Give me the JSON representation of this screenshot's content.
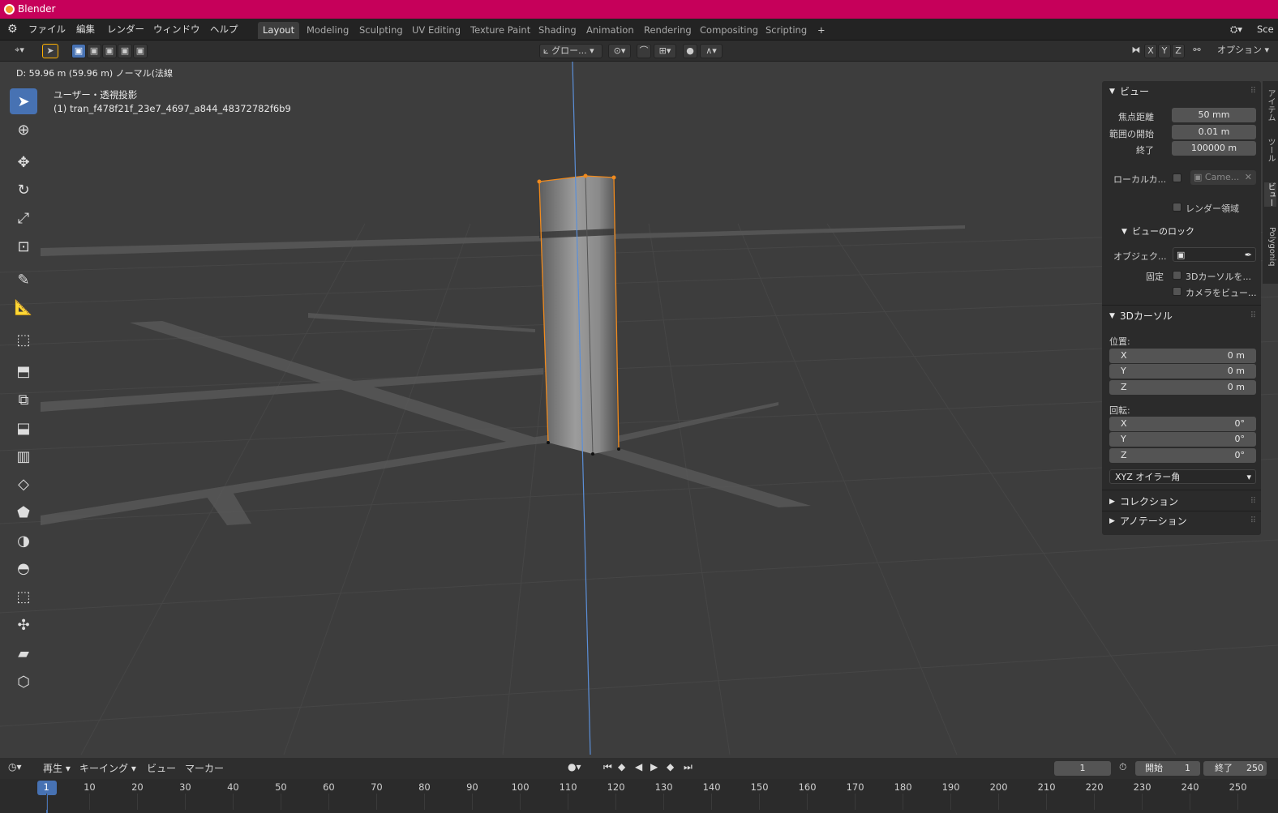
{
  "app": {
    "title": "Blender"
  },
  "menu": [
    "ファイル",
    "編集",
    "レンダー",
    "ウィンドウ",
    "ヘルプ"
  ],
  "workspaces": [
    "Layout",
    "Modeling",
    "Sculpting",
    "UV Editing",
    "Texture Paint",
    "Shading",
    "Animation",
    "Rendering",
    "Compositing",
    "Scripting"
  ],
  "workspace_add": "+",
  "scene_label": "Sce",
  "header": {
    "orientation": "グロー...",
    "axes": [
      "X",
      "Y",
      "Z"
    ],
    "options": "オプション"
  },
  "viewport": {
    "status": "D: 59.96 m (59.96 m) ノーマル(法線",
    "view_name": "ユーザー・透視投影",
    "object_name": "(1) tran_f478f21f_23e7_4697_a844_48372782f6b9"
  },
  "npanel": {
    "view_title": "ビュー",
    "focal_label": "焦点距離",
    "focal_value": "50 mm",
    "clip_start_label": "範囲の開始",
    "clip_start_value": "0.01 m",
    "clip_end_label": "終了",
    "clip_end_value": "100000 m",
    "local_camera_label": "ローカルカ...",
    "local_camera_value": "Came...",
    "render_region_label": "レンダー領域",
    "view_lock_title": "ビューのロック",
    "lock_object_label": "オブジェク...",
    "lock_fixed_label": "固定",
    "lock_3dcursor_label": "3Dカーソルを...",
    "lock_camera_label": "カメラをビュー...",
    "cursor_title": "3Dカーソル",
    "position_label": "位置:",
    "loc": [
      {
        "axis": "X",
        "value": "0 m"
      },
      {
        "axis": "Y",
        "value": "0 m"
      },
      {
        "axis": "Z",
        "value": "0 m"
      }
    ],
    "rotation_label": "回転:",
    "rot": [
      {
        "axis": "X",
        "value": "0°"
      },
      {
        "axis": "Y",
        "value": "0°"
      },
      {
        "axis": "Z",
        "value": "0°"
      }
    ],
    "rotation_mode": "XYZ オイラー角",
    "collection_title": "コレクション",
    "annotation_title": "アノテーション"
  },
  "sidetabs": [
    "アイテム",
    "ツール",
    "ビュー",
    "Polygoniq"
  ],
  "timeline": {
    "playback": "再生",
    "keying": "キーイング",
    "view": "ビュー",
    "marker": "マーカー",
    "current_frame": "1",
    "start_label": "開始",
    "start_value": "1",
    "end_label": "終了",
    "end_value": "250",
    "ruler": [
      "1",
      "10",
      "20",
      "30",
      "40",
      "50",
      "60",
      "70",
      "80",
      "90",
      "100",
      "110",
      "120",
      "130",
      "140",
      "150",
      "160",
      "170",
      "180",
      "190",
      "200",
      "210",
      "220",
      "230",
      "240",
      "250"
    ]
  },
  "colors": {
    "titlebar": "#c6005a",
    "selection": "#4772b3",
    "outline": "#f08a1d",
    "zaxis": "#5b8fd8"
  }
}
